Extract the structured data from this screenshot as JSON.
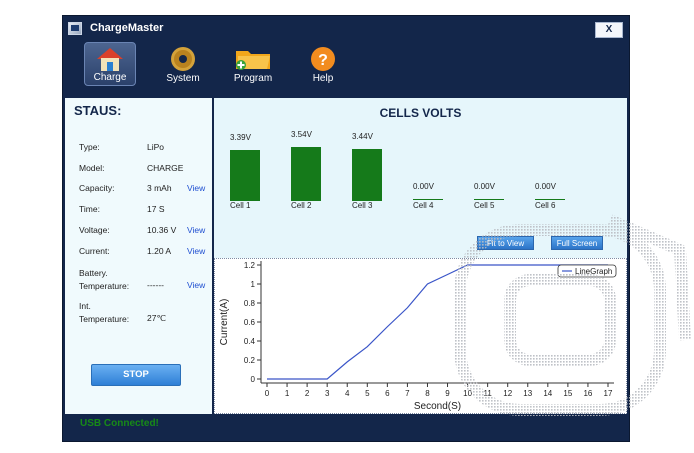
{
  "window": {
    "title": "ChargeMaster",
    "close_label": "X"
  },
  "toolbar": [
    {
      "label": "Charge",
      "icon": "house-icon",
      "active": true
    },
    {
      "label": "System",
      "icon": "gear-icon",
      "active": false
    },
    {
      "label": "Program",
      "icon": "folder-icon",
      "active": false
    },
    {
      "label": "Help",
      "icon": "help-icon",
      "active": false
    }
  ],
  "status_panel": {
    "heading": "STAUS:",
    "fields": [
      {
        "label": "Type:",
        "value": "LiPo",
        "view": ""
      },
      {
        "label": "Model:",
        "value": "CHARGE",
        "view": ""
      },
      {
        "label": "Capacity:",
        "value": "3 mAh",
        "view": "View"
      },
      {
        "label": "Time:",
        "value": "17 S",
        "view": ""
      },
      {
        "label": "Voltage:",
        "value": "10.36 V",
        "view": "View"
      },
      {
        "label": "Current:",
        "value": "1.20 A",
        "view": "View"
      },
      {
        "label": "Battery.\nTemperature:",
        "value": "------",
        "view": "View"
      },
      {
        "label": "Int.\nTemperature:",
        "value": "27℃",
        "view": ""
      }
    ],
    "stop_label": "STOP"
  },
  "cells": {
    "title": "CELLS VOLTS",
    "items": [
      {
        "name": "Cell 1",
        "volts_label": "3.39V",
        "volts": 3.39
      },
      {
        "name": "Cell 2",
        "volts_label": "3.54V",
        "volts": 3.54
      },
      {
        "name": "Cell 3",
        "volts_label": "3.44V",
        "volts": 3.44
      },
      {
        "name": "Cell 4",
        "volts_label": "0.00V",
        "volts": 0
      },
      {
        "name": "Cell 5",
        "volts_label": "0.00V",
        "volts": 0
      },
      {
        "name": "Cell 6",
        "volts_label": "0.00V",
        "volts": 0
      }
    ],
    "fit_to_view_label": "Fit to View",
    "full_screen_label": "Full Screen"
  },
  "chart_data": {
    "type": "line",
    "title": "",
    "xlabel": "Second(S)",
    "ylabel": "Current(A)",
    "legend": "LineGraph",
    "xlim": [
      0,
      17
    ],
    "ylim": [
      0,
      1.2
    ],
    "xticks": [
      "0",
      "1",
      "2",
      "3",
      "4",
      "5",
      "6",
      "7",
      "8",
      "9",
      "10",
      "11",
      "12",
      "13",
      "14",
      "15",
      "16",
      "17"
    ],
    "yticks": [
      "0",
      "0.2",
      "0.4",
      "0.6",
      "0.8",
      "1",
      "1.2"
    ],
    "series": [
      {
        "name": "LineGraph",
        "color": "#3a55c8",
        "x": [
          0,
          1,
          2,
          3,
          4,
          5,
          6,
          7,
          8,
          9,
          10,
          11,
          12,
          13,
          14,
          15,
          16,
          17
        ],
        "y": [
          0,
          0,
          0,
          0,
          0.18,
          0.34,
          0.55,
          0.75,
          1.0,
          1.1,
          1.2,
          1.2,
          1.2,
          1.2,
          1.2,
          1.2,
          1.2,
          1.2
        ]
      }
    ]
  },
  "status_bar": {
    "text": "USB  Connected!"
  },
  "colors": {
    "window": "#13264a",
    "panel": "#e6f6fb",
    "bar": "#157a1a",
    "accent_blue": "#2e7fd6",
    "status_green": "#178a17"
  }
}
